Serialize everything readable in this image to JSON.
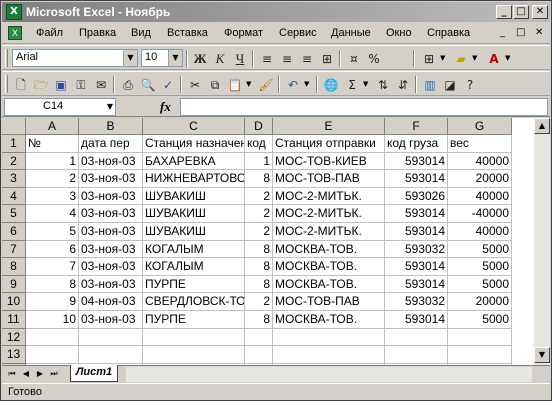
{
  "window": {
    "title": "Microsoft Excel - Ноябрь",
    "app_icon": "excel-icon",
    "min": "_",
    "max": "□",
    "close": "✕"
  },
  "menu": {
    "items": [
      "Файл",
      "Правка",
      "Вид",
      "Вставка",
      "Формат",
      "Сервис",
      "Данные",
      "Окно",
      "Справка"
    ],
    "doc_min": "_",
    "doc_restore": "□",
    "doc_close": "✕"
  },
  "format_toolbar": {
    "font": "Arial",
    "size": "10",
    "bold": "Ж",
    "italic": "К",
    "underline": "Ч"
  },
  "formula_bar": {
    "name_box": "C14",
    "fx": "fx",
    "formula": ""
  },
  "grid": {
    "columns": [
      "A",
      "B",
      "C",
      "D",
      "E",
      "F",
      "G"
    ],
    "rows": [
      [
        "№",
        "дата пер",
        "Станция назначения",
        "код",
        "Станция отправки",
        "код груза",
        "вес"
      ],
      [
        "1",
        "03-ноя-03",
        "БАХАРЕВКА",
        "1",
        "МОС-ТОВ-КИЕВ",
        "593014",
        "40000"
      ],
      [
        "2",
        "03-ноя-03",
        "НИЖНЕВАРТОВСК",
        "8",
        "МОС-ТОВ-ПАВ",
        "593014",
        "20000"
      ],
      [
        "3",
        "03-ноя-03",
        "ШУВАКИШ",
        "2",
        "МОС-2-МИТЬК.",
        "593026",
        "40000"
      ],
      [
        "4",
        "03-ноя-03",
        "ШУВАКИШ",
        "2",
        "МОС-2-МИТЬК.",
        "593014",
        "-40000"
      ],
      [
        "5",
        "03-ноя-03",
        "ШУВАКИШ",
        "2",
        "МОС-2-МИТЬК.",
        "593014",
        "40000"
      ],
      [
        "6",
        "03-ноя-03",
        "КОГАЛЫМ",
        "8",
        "МОСКВА-ТОВ.",
        "593032",
        "5000"
      ],
      [
        "7",
        "03-ноя-03",
        "КОГАЛЫМ",
        "8",
        "МОСКВА-ТОВ.",
        "593014",
        "5000"
      ],
      [
        "8",
        "03-ноя-03",
        "ПУРПЕ",
        "8",
        "МОСКВА-ТОВ.",
        "593014",
        "5000"
      ],
      [
        "9",
        "04-ноя-03",
        "СВЕРДЛОВСК-ТОВ",
        "2",
        "МОС-ТОВ-ПАВ",
        "593032",
        "20000"
      ],
      [
        "10",
        "03-ноя-03",
        "ПУРПЕ",
        "8",
        "МОСКВА-ТОВ.",
        "593014",
        "5000"
      ],
      [
        "",
        "",
        "",
        "",
        "",
        "",
        ""
      ],
      [
        "",
        "",
        "",
        "",
        "",
        "",
        ""
      ],
      [
        "",
        "",
        "",
        "",
        "",
        "",
        ""
      ]
    ]
  },
  "sheets": {
    "active": "Лист1"
  },
  "status": {
    "text": "Готово"
  }
}
